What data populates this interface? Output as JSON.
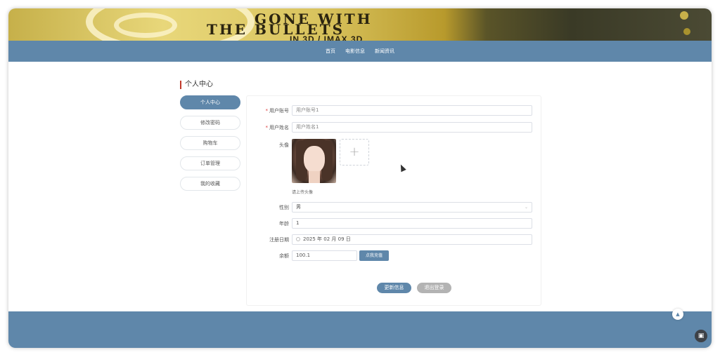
{
  "banner": {
    "title_line1": "GONE WITH",
    "title_line2": "THE BULLETS",
    "subtitle": "IN 3D / IMAX 3D"
  },
  "nav": {
    "items": [
      {
        "label": "首页"
      },
      {
        "label": "电影信息"
      },
      {
        "label": "新闻资讯"
      }
    ]
  },
  "page": {
    "title": "个人中心"
  },
  "sidebar": {
    "items": [
      {
        "label": "个人中心",
        "active": true
      },
      {
        "label": "修改密码"
      },
      {
        "label": "购物车"
      },
      {
        "label": "订单管理"
      },
      {
        "label": "我的收藏"
      }
    ]
  },
  "form": {
    "account": {
      "label": "用户账号",
      "value": "用户账号1"
    },
    "name": {
      "label": "用户姓名",
      "value": "用户姓名1"
    },
    "avatar": {
      "label": "头像",
      "hint": "请上传头像",
      "upload_icon": "+"
    },
    "gender": {
      "label": "性别",
      "value": "男"
    },
    "age": {
      "label": "年龄",
      "value": "1"
    },
    "reg_date": {
      "label": "注册日期",
      "value": "2025 年 02 月 09 日"
    },
    "balance": {
      "label": "余额",
      "value": "100.1",
      "recharge_label": "点我充值"
    },
    "update_label": "更新信息",
    "logout_label": "退出登录"
  },
  "icons": {
    "calendar": "calendar-icon",
    "chevron": "chevron-down-icon",
    "backtotop": "arrow-up-icon",
    "screenshot": "screenshot-icon"
  },
  "colors": {
    "brand": "#5f87aa",
    "accent": "#c0392b"
  }
}
